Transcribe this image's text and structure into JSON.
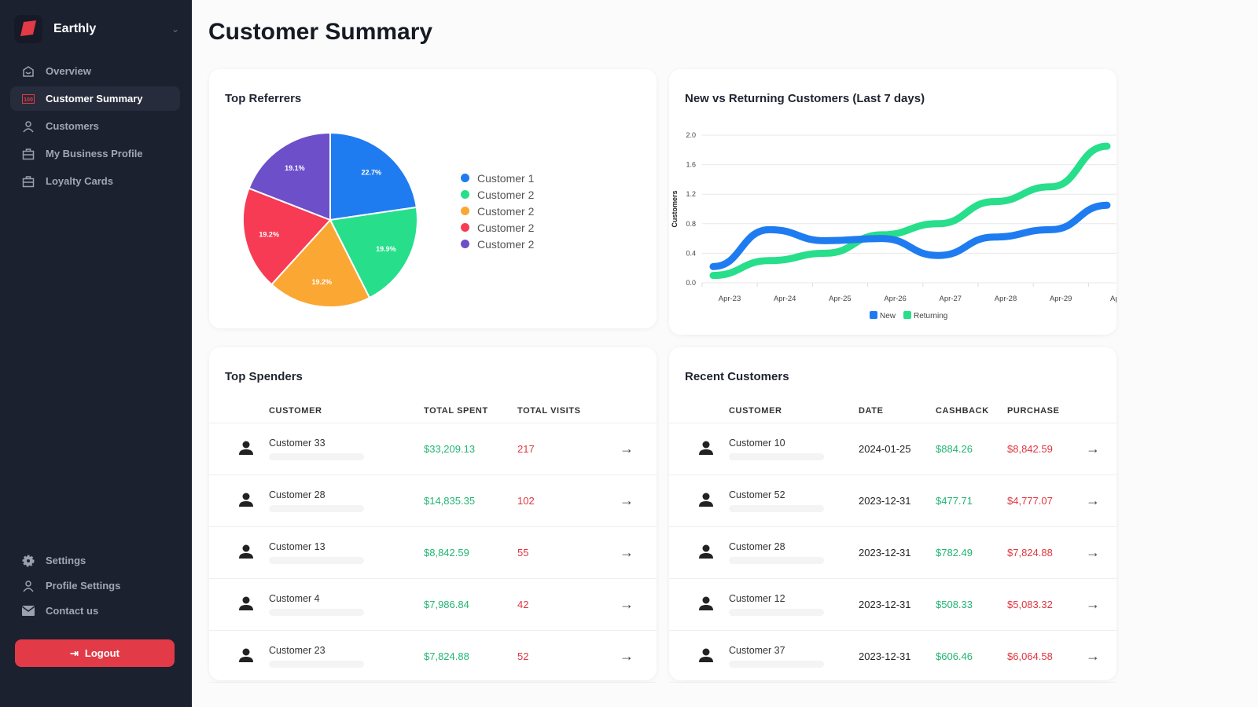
{
  "app": {
    "name": "Earthly"
  },
  "sidebar": {
    "items": [
      {
        "label": "Overview",
        "icon": "home-icon"
      },
      {
        "label": "Customer Summary",
        "icon": "summary-icon",
        "active": true
      },
      {
        "label": "Customers",
        "icon": "user-icon"
      },
      {
        "label": "My Business Profile",
        "icon": "briefcase-icon"
      },
      {
        "label": "Loyalty Cards",
        "icon": "briefcase-icon"
      }
    ],
    "bottom": [
      {
        "label": "Settings",
        "icon": "gear-icon"
      },
      {
        "label": "Profile Settings",
        "icon": "user-icon"
      },
      {
        "label": "Contact us",
        "icon": "mail-icon"
      }
    ],
    "logout": "Logout"
  },
  "page": {
    "title": "Customer Summary"
  },
  "colors": {
    "accent": "#e23a47",
    "green": "#22b573",
    "red": "#e0363f",
    "blue": "#1f7cf0",
    "returning": "#27de8b"
  },
  "chart_data": [
    {
      "type": "pie",
      "title": "Top Referrers",
      "slices": [
        {
          "label": "Customer 1",
          "value": 22.7,
          "color": "#1f7cf0"
        },
        {
          "label": "Customer 2",
          "value": 19.9,
          "color": "#27de8b"
        },
        {
          "label": "Customer 2",
          "value": 19.2,
          "color": "#fba734"
        },
        {
          "label": "Customer 2",
          "value": 19.2,
          "color": "#f73b55"
        },
        {
          "label": "Customer 2",
          "value": 19.1,
          "color": "#6d4fc9"
        }
      ],
      "legend": "right"
    },
    {
      "type": "line",
      "title": "New vs Returning Customers (Last 7 days)",
      "ylabel": "Customers",
      "ylim": [
        0,
        2
      ],
      "yticks": [
        0.0,
        0.4,
        0.8,
        1.2,
        1.6,
        2.0
      ],
      "categories": [
        "Apr-23",
        "Apr-24",
        "Apr-25",
        "Apr-26",
        "Apr-27",
        "Apr-28",
        "Apr-29",
        "Apr"
      ],
      "grid": true,
      "legend": "bottom",
      "series": [
        {
          "name": "New",
          "color": "#1f7cf0",
          "values": [
            0.22,
            0.72,
            0.57,
            0.6,
            0.37,
            0.62,
            0.72,
            1.05
          ]
        },
        {
          "name": "Returning",
          "color": "#27de8b",
          "values": [
            0.1,
            0.3,
            0.4,
            0.65,
            0.8,
            1.1,
            1.3,
            1.85
          ]
        }
      ]
    }
  ],
  "top_spenders": {
    "title": "Top Spenders",
    "columns": [
      "CUSTOMER",
      "TOTAL SPENT",
      "TOTAL VISITS"
    ],
    "rows": [
      {
        "name": "Customer 33",
        "spent": "$33,209.13",
        "visits": "217"
      },
      {
        "name": "Customer 28",
        "spent": "$14,835.35",
        "visits": "102"
      },
      {
        "name": "Customer 13",
        "spent": "$8,842.59",
        "visits": "55"
      },
      {
        "name": "Customer 4",
        "spent": "$7,986.84",
        "visits": "42"
      },
      {
        "name": "Customer 23",
        "spent": "$7,824.88",
        "visits": "52"
      }
    ]
  },
  "recent": {
    "title": "Recent Customers",
    "columns": [
      "CUSTOMER",
      "DATE",
      "CASHBACK",
      "PURCHASE"
    ],
    "rows": [
      {
        "name": "Customer 10",
        "date": "2024-01-25",
        "cashback": "$884.26",
        "purchase": "$8,842.59"
      },
      {
        "name": "Customer 52",
        "date": "2023-12-31",
        "cashback": "$477.71",
        "purchase": "$4,777.07"
      },
      {
        "name": "Customer 28",
        "date": "2023-12-31",
        "cashback": "$782.49",
        "purchase": "$7,824.88"
      },
      {
        "name": "Customer 12",
        "date": "2023-12-31",
        "cashback": "$508.33",
        "purchase": "$5,083.32"
      },
      {
        "name": "Customer 37",
        "date": "2023-12-31",
        "cashback": "$606.46",
        "purchase": "$6,064.58"
      }
    ]
  }
}
